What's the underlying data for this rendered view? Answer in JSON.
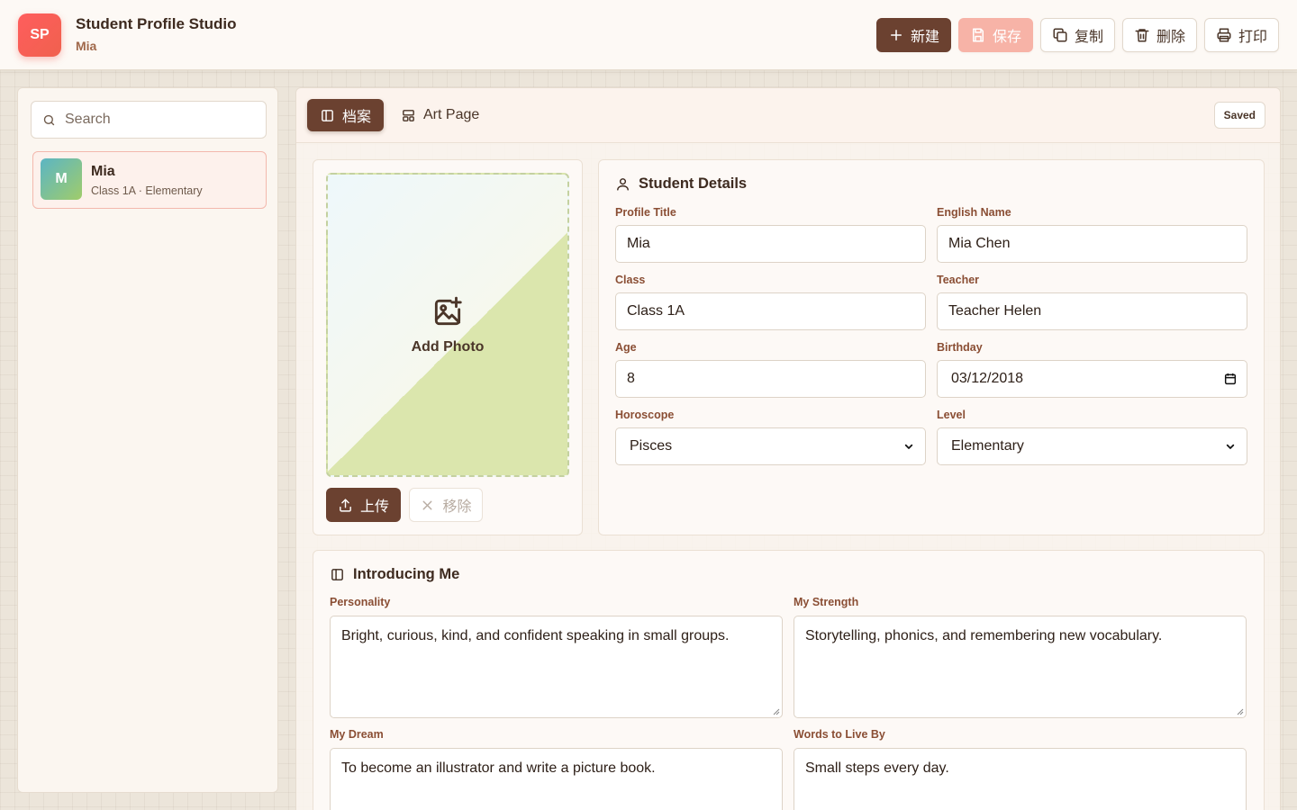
{
  "app": {
    "logo": "SP",
    "title": "Student Profile Studio",
    "subtitle": "Mia"
  },
  "toolbar": {
    "new_label": "新建",
    "save_label": "保存",
    "copy_label": "复制",
    "delete_label": "删除",
    "print_label": "打印"
  },
  "sidebar": {
    "search_placeholder": "Search",
    "students": [
      {
        "initial": "M",
        "name": "Mia",
        "meta": "Class 1A · Elementary"
      }
    ]
  },
  "tabs": [
    {
      "label": "档案",
      "icon": "book-icon",
      "active": true
    },
    {
      "label": "Art Page",
      "icon": "layout-icon",
      "active": false
    }
  ],
  "status": "Saved",
  "photo": {
    "placeholder": "Add Photo",
    "upload_label": "上传",
    "remove_label": "移除"
  },
  "details": {
    "title": "Student Details",
    "fields": {
      "profile_title": {
        "label": "Profile Title",
        "value": "Mia"
      },
      "english_name": {
        "label": "English Name",
        "value": "Mia Chen"
      },
      "class": {
        "label": "Class",
        "value": "Class 1A"
      },
      "teacher": {
        "label": "Teacher",
        "value": "Teacher Helen"
      },
      "age": {
        "label": "Age",
        "value": "8"
      },
      "birthday": {
        "label": "Birthday",
        "value": "03/12/2018"
      },
      "horoscope": {
        "label": "Horoscope",
        "value": "Pisces"
      },
      "level": {
        "label": "Level",
        "value": "Elementary"
      }
    }
  },
  "intro": {
    "title": "Introducing Me",
    "personality": {
      "label": "Personality",
      "value": "Bright, curious, kind, and confident speaking in small groups."
    },
    "strength": {
      "label": "My Strength",
      "value": "Storytelling, phonics, and remembering new vocabulary."
    },
    "dream": {
      "label": "My Dream",
      "value": "To become an illustrator and write a picture book."
    },
    "words": {
      "label": "Words to Live By",
      "value": "Small steps every day."
    }
  },
  "colors": {
    "brand": "#6b4130",
    "accent": "#ff5d5d",
    "label": "#8a4e34",
    "save_disabled": "#f7b3a7"
  }
}
